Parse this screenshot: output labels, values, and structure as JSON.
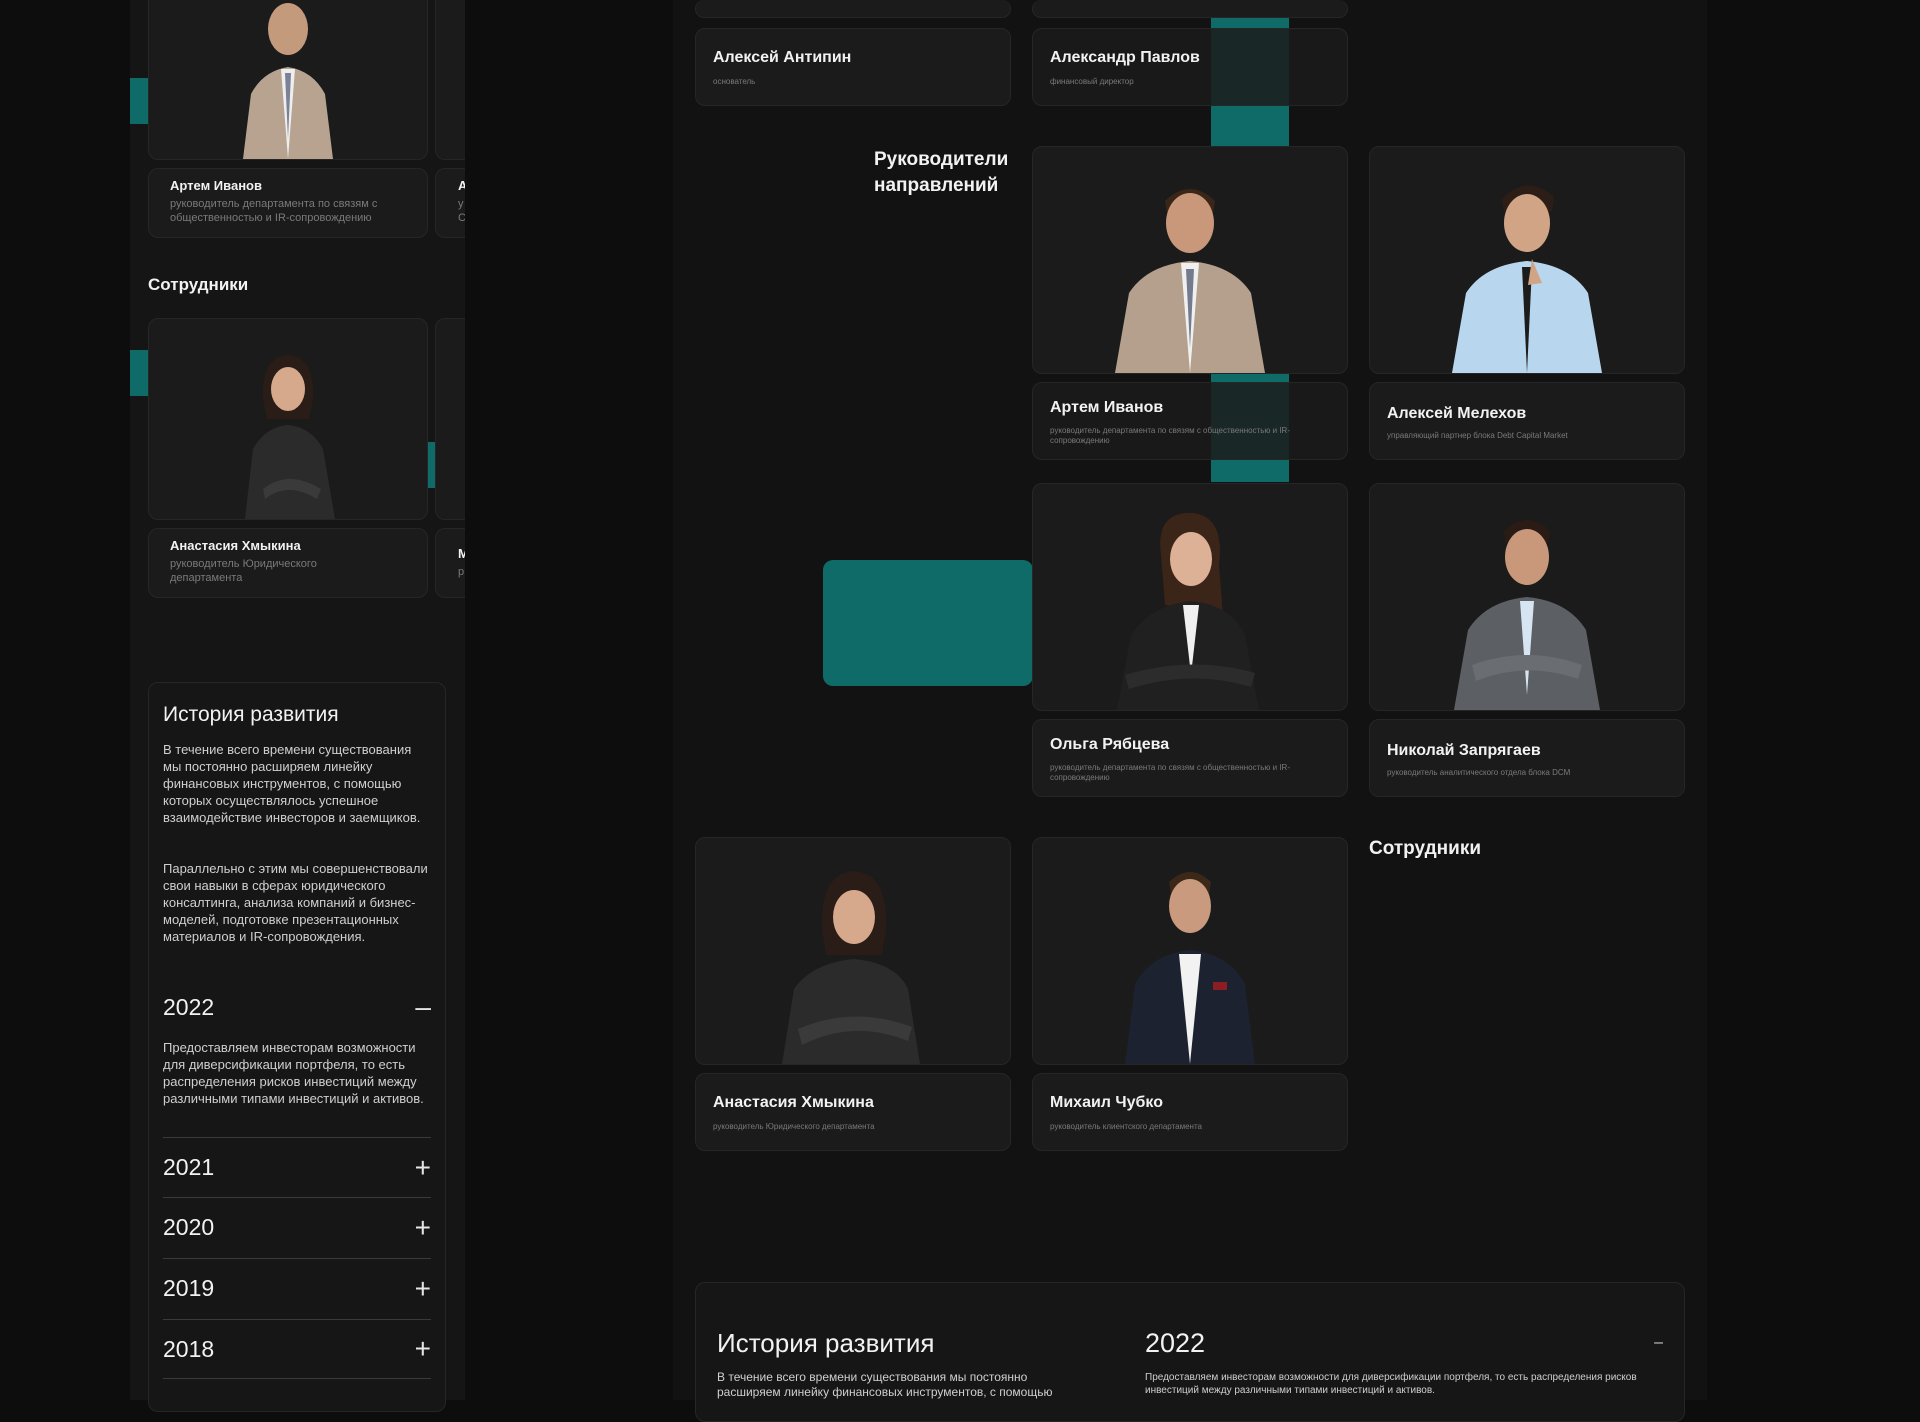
{
  "colors": {
    "bg": "#0d0d0d",
    "panel": "#151515",
    "card": "#1b1b1b",
    "accent_teal": "#0f6b67"
  },
  "mobile": {
    "top_person": {
      "name": "Артем Иванов",
      "role": "руководитель департамента по связям с общественностью и IR-сопровождению"
    },
    "peek_card_a": {
      "name_fragment": "А",
      "role_fragment_1": "у",
      "role_fragment_2": "С"
    },
    "employees_heading": "Сотрудники",
    "employee": {
      "name": "Анастасия Хмыкина",
      "role": "руководитель Юридического департамента"
    },
    "peek_card_m": {
      "name_fragment": "М",
      "role_fragment": "р"
    },
    "history": {
      "title": "История развития",
      "para1": "В течение всего времени существования мы постоянно расширяем линейку финансовых инструментов, с помощью которых осуществлялось успешное взаимодействие инвесторов и заемщиков.",
      "para2": "Параллельно с этим мы совершенствовали свои навыки в сферах юридического консалтинга, анализа компаний и бизнес-моделей, подготовке презентационных материалов и IR-сопровождения.",
      "open_year": "2022",
      "open_icon": "–",
      "open_text": "Предоставляем инвесторам возможности для диверсификации портфеля, то есть распределения рисков инвестиций между различными типами инвестиций и активов.",
      "years": [
        {
          "label": "2021",
          "icon": "+"
        },
        {
          "label": "2020",
          "icon": "+"
        },
        {
          "label": "2019",
          "icon": "+"
        },
        {
          "label": "2018",
          "icon": "+"
        }
      ]
    }
  },
  "desktop": {
    "founders": [
      {
        "name": "Алексей Антипин",
        "role": "основатель"
      },
      {
        "name": "Александр Павлов",
        "role": "финансовый директор"
      }
    ],
    "heads_heading": "Руководители направлений",
    "heads": [
      {
        "name": "Артем Иванов",
        "role": "руководитель департамента по связям  с общественностью и IR-сопровождению"
      },
      {
        "name": "Алексей Мелехов",
        "role": "управляющий партнер блока Debt Capital Market"
      },
      {
        "name": "Ольга Рябцева",
        "role": "руководитель департамента по связям  с общественностью и IR-сопровождению"
      },
      {
        "name": "Николай Запрягаев",
        "role": "руководитель аналитического отдела блока DCM"
      }
    ],
    "employees_heading": "Сотрудники",
    "employees": [
      {
        "name": "Анастасия Хмыкина",
        "role": "руководитель Юридического департамента"
      },
      {
        "name": "Михаил Чубко",
        "role": "руководитель клиентского департамента"
      }
    ],
    "history": {
      "title": "История развития",
      "text": "В течение всего времени существования мы постоянно расширяем линейку финансовых инструментов, с помощью",
      "year": "2022",
      "year_icon": "–",
      "year_text": "Предоставляем инвесторам возможности для диверсификации портфеля, то есть распределения рисков инвестиций между различными типами инвестиций и активов."
    }
  }
}
